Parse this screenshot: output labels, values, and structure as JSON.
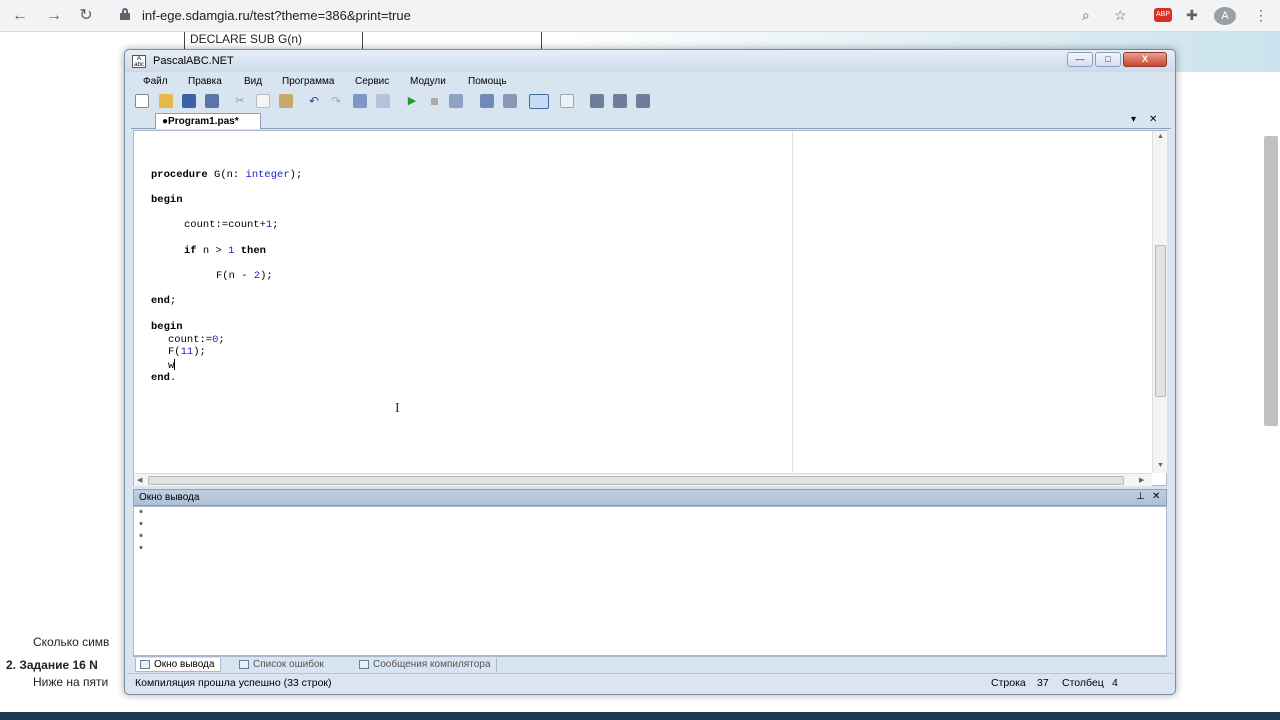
{
  "browser": {
    "back_icon": "arrow-left-icon",
    "forward_icon": "arrow-right-icon",
    "reload_icon": "reload-icon",
    "url": "inf-ege.sdamgia.ru/test?theme=386&print=true",
    "zoom_icon": "zoom-icon",
    "star_icon": "star-icon",
    "extension_badge": "ABP",
    "extensions_icon": "puzzle-icon",
    "avatar_letter": "A",
    "menu_icon": "kebab-menu-icon"
  },
  "background_page": {
    "table_cell": "DECLARE SUB G(n)",
    "question_text": "Сколько симв",
    "task_heading": "2. Задание 16 N",
    "task_intro": "Ниже на пяти"
  },
  "ide": {
    "title": "PascalABC.NET",
    "app_icon_label": "A/\nabc",
    "window_buttons": {
      "minimize": "—",
      "maximize": "□",
      "close": "X"
    },
    "menu": [
      "Файл",
      "Правка",
      "Вид",
      "Программа",
      "Сервис",
      "Модули",
      "Помощь"
    ],
    "toolbar_icons": [
      "new-file-icon",
      "open-folder-icon",
      "save-icon",
      "save-all-icon",
      "cut-icon",
      "copy-icon",
      "paste-icon",
      "undo-icon",
      "redo-icon",
      "find-icon",
      "replace-icon",
      "run-icon",
      "stop-icon",
      "compile-icon",
      "debug-step-icon",
      "debug-over-icon",
      "console-icon",
      "window-icon",
      "format-icon",
      "outline-icon",
      "settings-icon"
    ],
    "active_tab": "●Program1.pas*",
    "tab_controls": {
      "dropdown": "▾",
      "close": "✕"
    },
    "code": {
      "proc_kw": "procedure",
      "proc_name": " G(n: ",
      "proc_type": "integer",
      "proc_end": ");",
      "begin1": "begin",
      "count_stmt_a": "count:=count+",
      "count_stmt_num": "1",
      "count_stmt_b": ";",
      "if_kw": "if",
      "if_cond_a": " n > ",
      "if_cond_num": "1",
      "then_kw": " then",
      "call_a": "F(n - ",
      "call_num": "2",
      "call_b": ");",
      "end1": "end",
      "end1_semi": ";",
      "begin2": "begin",
      "init_a": "count:=",
      "init_num": "0",
      "init_b": ";",
      "main_call_a": "F(",
      "main_call_num": "11",
      "main_call_b": ");",
      "typed": "w",
      "end2": "end",
      "end2_dot": "."
    },
    "output_panel": {
      "title": "Окно вывода",
      "pin": "⊥",
      "close": "✕",
      "lines": [
        "*",
        "*",
        "*",
        "*"
      ]
    },
    "bottom_tabs": [
      "Окно вывода",
      "Список ошибок",
      "Сообщения компилятора"
    ],
    "status": {
      "message": "Компиляция прошла успешно (33 строк)",
      "line_label": "Строка",
      "line_value": "37",
      "col_label": "Столбец",
      "col_value": "4"
    }
  },
  "colors": {
    "keyword_blue": "#1a22c8",
    "window_frame": "#d9e4f1",
    "close_red": "#c7452d"
  }
}
